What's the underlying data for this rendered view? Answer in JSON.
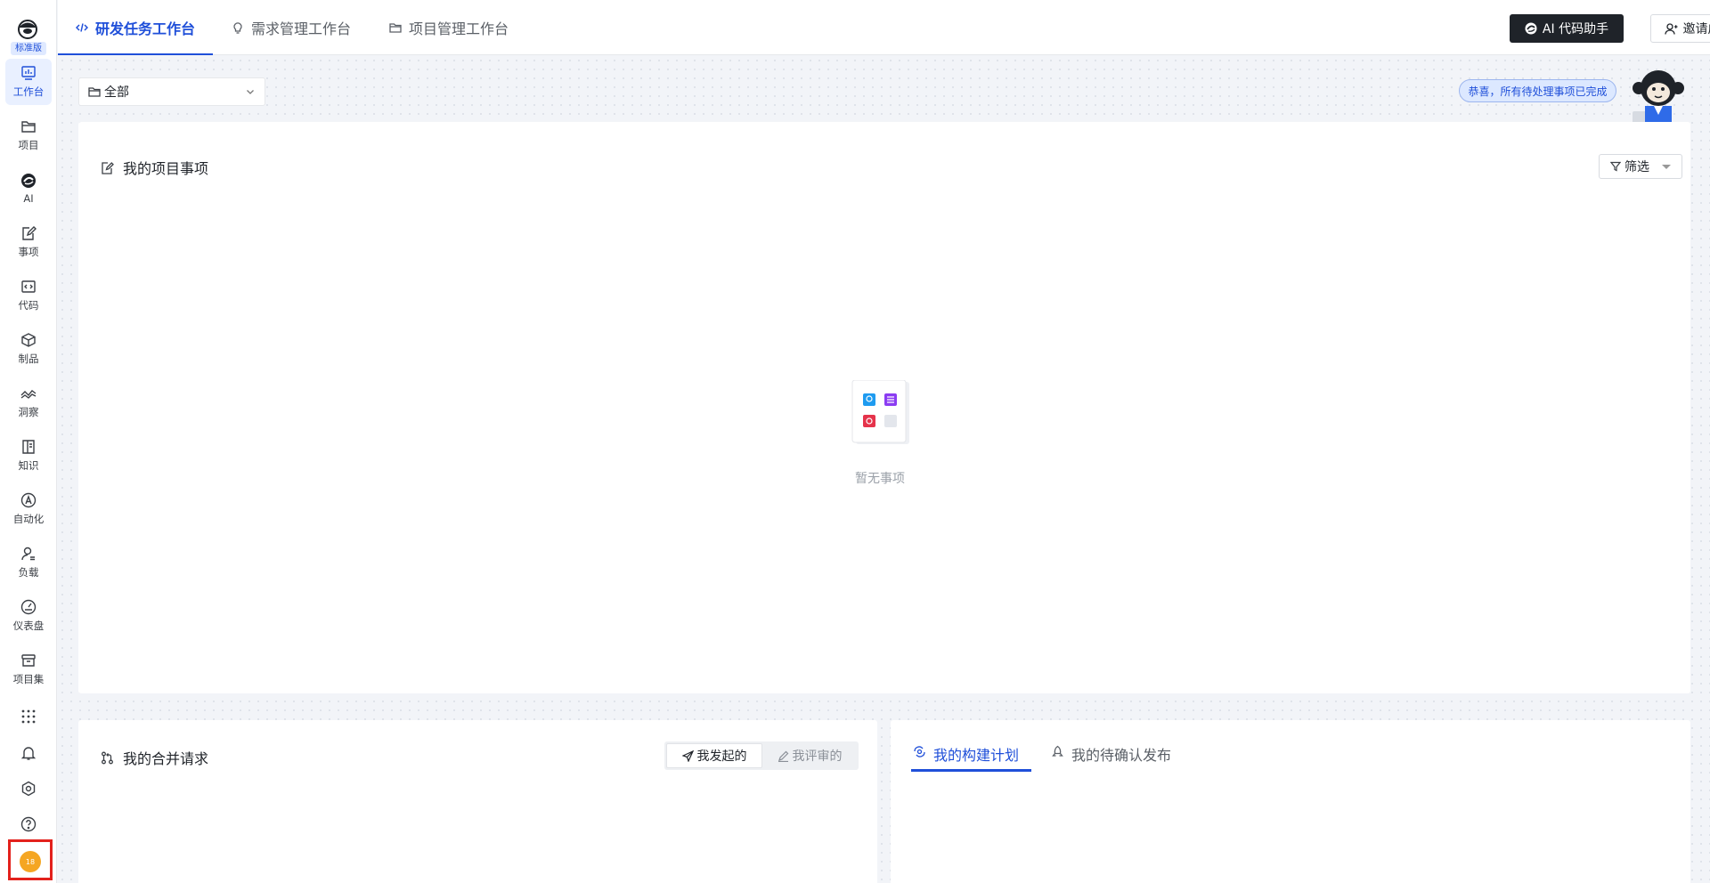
{
  "sidebar": {
    "edition_badge": "标准版",
    "items": [
      {
        "label": "工作台",
        "icon": "dashboard-chart-icon",
        "active": true
      },
      {
        "label": "项目",
        "icon": "folder-icon"
      },
      {
        "label": "AI",
        "icon": "ai-logo-icon"
      },
      {
        "label": "事项",
        "icon": "edit-doc-icon"
      },
      {
        "label": "代码",
        "icon": "code-icon"
      },
      {
        "label": "制品",
        "icon": "package-icon"
      },
      {
        "label": "洞察",
        "icon": "insight-wave-icon"
      },
      {
        "label": "知识",
        "icon": "book-icon"
      },
      {
        "label": "自动化",
        "icon": "automation-icon"
      },
      {
        "label": "负载",
        "icon": "user-load-icon"
      },
      {
        "label": "仪表盘",
        "icon": "gauge-icon"
      },
      {
        "label": "项目集",
        "icon": "archive-icon"
      }
    ],
    "utilities": [
      "apps-grid-icon",
      "bell-icon",
      "settings-icon",
      "help-icon"
    ],
    "avatar_text": "18"
  },
  "topbar": {
    "tabs": [
      {
        "label": "研发任务工作台",
        "icon": "code-icon",
        "active": true
      },
      {
        "label": "需求管理工作台",
        "icon": "bulb-icon"
      },
      {
        "label": "项目管理工作台",
        "icon": "folder-icon"
      }
    ],
    "ai_button": "AI 代码助手",
    "invite_button": "邀请成员"
  },
  "content": {
    "scope_select": {
      "value": "全部"
    },
    "congrats_text": "恭喜，所有待处理事项已完成",
    "project_items": {
      "title": "我的项目事项",
      "filter_label": "筛选",
      "empty_text": "暂无事项"
    },
    "merge_requests": {
      "title": "我的合并请求",
      "segments": [
        {
          "label": "我发起的",
          "active": true
        },
        {
          "label": "我评审的"
        }
      ]
    },
    "builds": {
      "tabs": [
        {
          "label": "我的构建计划",
          "active": true
        },
        {
          "label": "我的待确认发布"
        }
      ]
    }
  },
  "colors": {
    "accent": "#1f4fd9",
    "annotation_red": "#e3211c",
    "avatar_bg": "#f5a623"
  }
}
